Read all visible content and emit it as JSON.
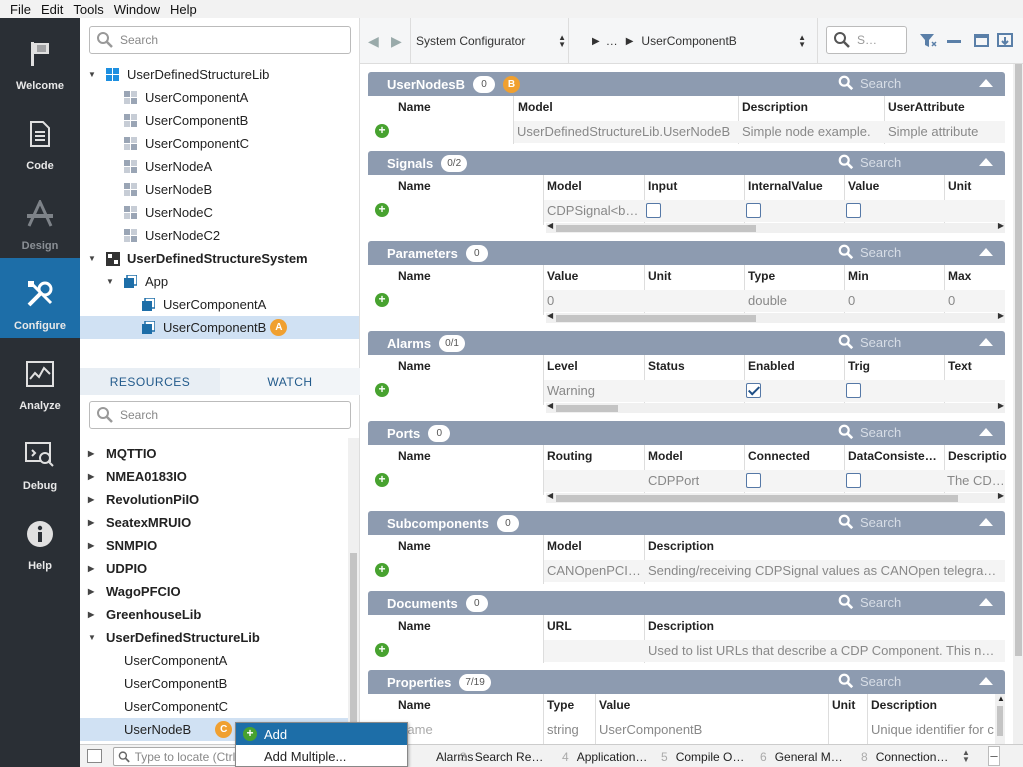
{
  "menu": [
    "File",
    "Edit",
    "Tools",
    "Window",
    "Help"
  ],
  "modes": [
    {
      "label": "Welcome",
      "icon": "flag-icon"
    },
    {
      "label": "Code",
      "icon": "document-icon"
    },
    {
      "label": "Design",
      "icon": "design-icon"
    },
    {
      "label": "Configure",
      "icon": "tools-icon"
    },
    {
      "label": "Analyze",
      "icon": "chart-icon"
    },
    {
      "label": "Debug",
      "icon": "debug-icon"
    },
    {
      "label": "Help",
      "icon": "info-icon"
    }
  ],
  "tree": {
    "search_placeholder": "Search",
    "items": [
      {
        "label": "UserDefinedStructureLib",
        "bold": false
      },
      {
        "label": "UserComponentA"
      },
      {
        "label": "UserComponentB"
      },
      {
        "label": "UserComponentC"
      },
      {
        "label": "UserNodeA"
      },
      {
        "label": "UserNodeB"
      },
      {
        "label": "UserNodeC"
      },
      {
        "label": "UserNodeC2"
      },
      {
        "label": "UserDefinedStructureSystem"
      },
      {
        "label": "App"
      },
      {
        "label": "UserComponentA"
      },
      {
        "label": "UserComponentB"
      }
    ],
    "badge_a": "A"
  },
  "resources": {
    "tabs": [
      "RESOURCES",
      "WATCH"
    ],
    "search_placeholder": "Search",
    "items": [
      "MQTTIO",
      "NMEA0183IO",
      "RevolutionPiIO",
      "SeatexMRUIO",
      "SNMPIO",
      "UDPIO",
      "WagoPFCIO",
      "GreenhouseLib",
      "UserDefinedStructureLib",
      "UserComponentA",
      "UserComponentB",
      "UserComponentC",
      "UserNodeB"
    ],
    "badge_c": "C"
  },
  "context_menu": {
    "items": [
      "Add",
      "Add Multiple..."
    ]
  },
  "toolbar": {
    "combo1": "System Configurator",
    "ellipsis": "…",
    "combo2": "UserComponentB",
    "search_placeholder": "S…"
  },
  "sections": {
    "nodes": {
      "title": "UserNodesB",
      "count": "0",
      "badge": "B",
      "search": "Search",
      "headers": [
        "Name",
        "Model",
        "Description",
        "UserAttribute"
      ],
      "row": [
        "UserDefinedStructureLib.UserNodeB",
        "Simple node example.",
        "Simple attribute"
      ]
    },
    "signals": {
      "title": "Signals",
      "count": "0/2",
      "search": "Search",
      "headers": [
        "Name",
        "Model",
        "Input",
        "InternalValue",
        "Value",
        "Unit"
      ],
      "row": [
        "CDPSignal<b…"
      ]
    },
    "parameters": {
      "title": "Parameters",
      "count": "0",
      "search": "Search",
      "headers": [
        "Name",
        "Value",
        "Unit",
        "Type",
        "Min",
        "Max"
      ],
      "row": [
        "0",
        "double",
        "0",
        "0"
      ]
    },
    "alarms": {
      "title": "Alarms",
      "count": "0/1",
      "search": "Search",
      "headers": [
        "Name",
        "Level",
        "Status",
        "Enabled",
        "Trig",
        "Text"
      ],
      "row": [
        "Warning"
      ]
    },
    "ports": {
      "title": "Ports",
      "count": "0",
      "search": "Search",
      "headers": [
        "Name",
        "Routing",
        "Model",
        "Connected",
        "DataConsiste…",
        "Descriptio"
      ],
      "row": [
        "CDPPort",
        "The CDPP"
      ]
    },
    "subcomponents": {
      "title": "Subcomponents",
      "count": "0",
      "search": "Search",
      "headers": [
        "Name",
        "Model",
        "Description"
      ],
      "row": [
        "CANOpenPCI…",
        "Sending/receiving CDPSignal values as CANOpen telegra…"
      ]
    },
    "documents": {
      "title": "Documents",
      "count": "0",
      "search": "Search",
      "headers": [
        "Name",
        "URL",
        "Description"
      ],
      "row": [
        "Used to list URLs that describe a CDP Component. This no…"
      ]
    },
    "properties": {
      "title": "Properties",
      "count": "7/19",
      "search": "Search",
      "headers": [
        "Name",
        "Type",
        "Value",
        "Unit",
        "Description"
      ],
      "row": [
        "Name",
        "string",
        "UserComponentB",
        "Unique identifier for c"
      ]
    }
  },
  "statusbar": {
    "locate_placeholder": "Type to locate (Ctrl+K)",
    "tabs": [
      {
        "num": "",
        "label": "Alarms"
      },
      {
        "num": "3",
        "label": "Search Re…"
      },
      {
        "num": "4",
        "label": "Application…"
      },
      {
        "num": "5",
        "label": "Compile O…"
      },
      {
        "num": "6",
        "label": "General M…"
      },
      {
        "num": "8",
        "label": "Connection…"
      }
    ]
  }
}
